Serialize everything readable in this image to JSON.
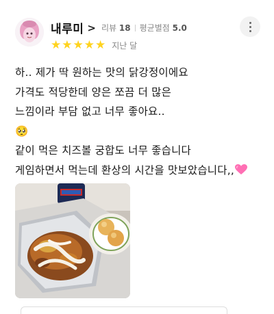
{
  "user": {
    "name": "내루미",
    "chevron": ">",
    "review_label": "리뷰",
    "review_count": "18",
    "avg_label": "평균별점",
    "avg_rating": "5.0"
  },
  "rating": {
    "stars": 5,
    "max": 5,
    "star_color": "#ffd31e",
    "date": "지난 달"
  },
  "review": {
    "lines": [
      "하.. 제가 딱 원하는 맛의 닭강정이에요",
      "가격도 적당한데 양은 쪼끔 더 많은",
      "느낌이라 부담 없고 너무 좋아요..",
      "🥺",
      "같이 먹은 치즈볼 궁합도 너무 좋습니다",
      "게임하면서 먹는데 환상의 시간을 맛보았습니다,,"
    ],
    "end_emoji": "pink-heart-icon"
  },
  "photo": {
    "icon": "food-photo"
  }
}
